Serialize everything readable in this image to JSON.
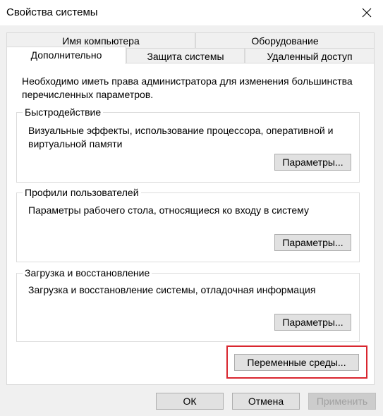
{
  "window": {
    "title": "Свойства системы"
  },
  "icons": {
    "close": "close-icon"
  },
  "tabs": {
    "row1": [
      "Имя компьютера",
      "Оборудование"
    ],
    "row2": [
      "Дополнительно",
      "Защита системы",
      "Удаленный доступ"
    ],
    "active": "Дополнительно"
  },
  "intro": "Необходимо иметь права администратора для изменения большинства перечисленных параметров.",
  "groups": {
    "performance": {
      "title": "Быстродействие",
      "description": "Визуальные эффекты, использование процессора, оперативной и виртуальной памяти",
      "button": "Параметры..."
    },
    "profiles": {
      "title": "Профили пользователей",
      "description": "Параметры рабочего стола, относящиеся ко входу в систему",
      "button": "Параметры..."
    },
    "startup": {
      "title": "Загрузка и восстановление",
      "description": "Загрузка и восстановление системы, отладочная информация",
      "button": "Параметры..."
    }
  },
  "env_button": "Переменные среды...",
  "footer": {
    "ok": "ОК",
    "cancel": "Отмена",
    "apply": "Применить"
  },
  "colors": {
    "highlight": "#d9262f",
    "panel": "#ffffff",
    "chrome": "#f0f0f0"
  }
}
